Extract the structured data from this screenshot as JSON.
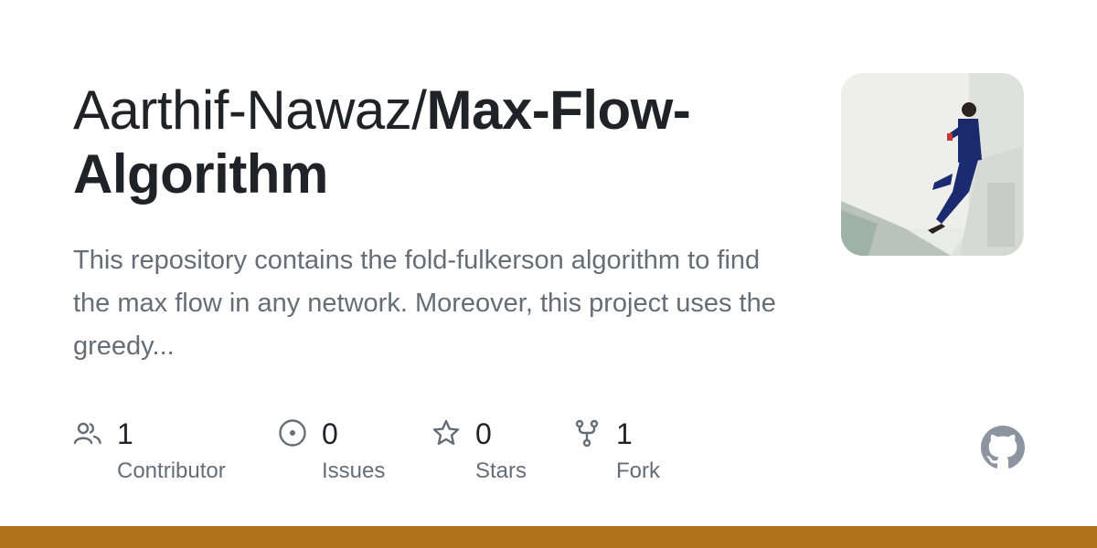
{
  "repo": {
    "owner": "Aarthif-Nawaz/",
    "name": "Max-Flow-Algorithm",
    "description": "This repository contains the fold-fulkerson algorithm to find the max flow in any network. Moreover, this project uses the greedy..."
  },
  "stats": [
    {
      "icon": "people-icon",
      "value": "1",
      "label": "Contributor"
    },
    {
      "icon": "issue-icon",
      "value": "0",
      "label": "Issues"
    },
    {
      "icon": "star-icon",
      "value": "0",
      "label": "Stars"
    },
    {
      "icon": "fork-icon",
      "value": "1",
      "label": "Fork"
    }
  ],
  "colors": {
    "text_primary": "#1f2328",
    "text_secondary": "#656d76",
    "language_bar": "#b07219",
    "github_logo": "#8c959f"
  }
}
